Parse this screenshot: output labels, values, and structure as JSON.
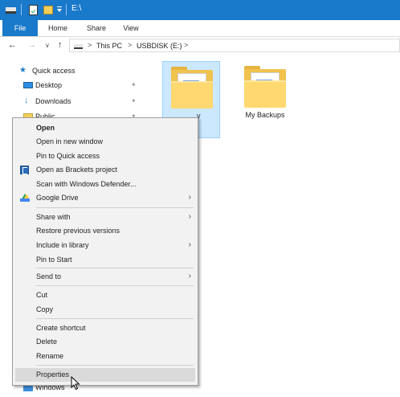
{
  "window": {
    "title": "E:\\"
  },
  "ribbon": {
    "tabs": [
      "File",
      "Home",
      "Share",
      "View"
    ],
    "active_tab": "File"
  },
  "address_bar": {
    "crumbs": [
      "This PC",
      "USBDISK (E:)"
    ],
    "separator": ">"
  },
  "sidebar": {
    "items": [
      {
        "label": "Quick access",
        "icon": "star-icon"
      },
      {
        "label": "Desktop",
        "icon": "desktop-icon",
        "pinned": true
      },
      {
        "label": "Downloads",
        "icon": "download-icon",
        "pinned": true
      },
      {
        "label": "Public",
        "icon": "folder-icon",
        "pinned": true
      },
      {
        "label": "Windows",
        "icon": "windows-drive-icon"
      }
    ]
  },
  "files": [
    {
      "name": "My Library",
      "visible_name": "y",
      "selected": true
    },
    {
      "name": "My Backups",
      "visible_name": "My Backups",
      "selected": false
    }
  ],
  "context_menu": {
    "groups": [
      [
        {
          "label": "Open",
          "bold": true
        },
        {
          "label": "Open in new window"
        },
        {
          "label": "Pin to Quick access"
        },
        {
          "label": "Open as Brackets project",
          "icon": "brackets-icon"
        },
        {
          "label": "Scan with Windows Defender..."
        },
        {
          "label": "Google Drive",
          "icon": "google-drive-icon",
          "submenu": true
        }
      ],
      [
        {
          "label": "Share with",
          "submenu": true
        },
        {
          "label": "Restore previous versions"
        },
        {
          "label": "Include in library",
          "submenu": true
        },
        {
          "label": "Pin to Start"
        }
      ],
      [
        {
          "label": "Send to",
          "submenu": true
        }
      ],
      [
        {
          "label": "Cut"
        },
        {
          "label": "Copy"
        }
      ],
      [
        {
          "label": "Create shortcut"
        },
        {
          "label": "Delete"
        },
        {
          "label": "Rename"
        }
      ],
      [
        {
          "label": "Properties",
          "hovered": true
        }
      ]
    ]
  },
  "colors": {
    "accent": "#1979ca",
    "selection": "#cce8ff",
    "menu_bg": "#f2f2f2",
    "menu_hover": "#dadada"
  }
}
